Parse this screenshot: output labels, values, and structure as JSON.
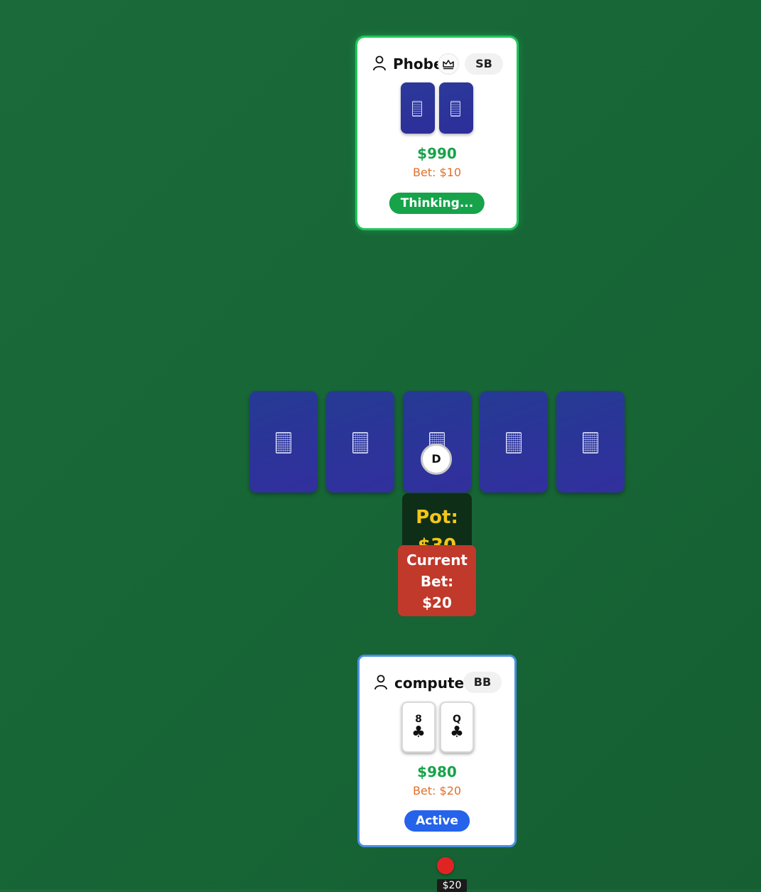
{
  "opponent": {
    "name": "Phobe",
    "badge": "SB",
    "chips": "$990",
    "bet": "Bet: $10",
    "status": "Thinking...",
    "status_color": "#16a34a",
    "has_crown": true,
    "cards": [
      "face-down",
      "face-down"
    ]
  },
  "player": {
    "name": "computer",
    "badge": "BB",
    "chips": "$980",
    "bet": "Bet: $20",
    "status": "Active",
    "status_color": "#2563eb",
    "cards": [
      {
        "rank": "8",
        "suit": "♣"
      },
      {
        "rank": "Q",
        "suit": "♣"
      }
    ]
  },
  "board": {
    "cards": [
      "face-down",
      "face-down",
      "face-down",
      "face-down",
      "face-down"
    ],
    "dealer_button": "D"
  },
  "pot": {
    "label": "Pot:",
    "value": "$30"
  },
  "current_bet": {
    "line1": "Current",
    "line2": "Bet:",
    "value": "$20"
  },
  "player_chip_bet": "$20",
  "colors": {
    "table": "#1b6b3a",
    "chips_text": "#16a34a",
    "bet_text": "#e0702a",
    "pot_text": "#f5c518",
    "current_bet_bg": "#c0392b",
    "card_back": "#2d2d9a"
  }
}
